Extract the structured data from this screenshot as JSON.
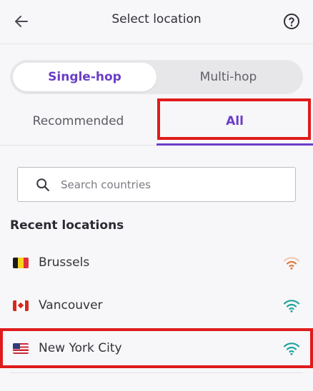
{
  "header": {
    "title": "Select location",
    "back_icon": "arrow-left-icon",
    "help_icon": "question-circle-icon"
  },
  "hop_modes": {
    "single": "Single-hop",
    "multi": "Multi-hop",
    "selected": "single"
  },
  "tabs": {
    "recommended": "Recommended",
    "all": "All",
    "selected": "all"
  },
  "search": {
    "placeholder": "Search countries",
    "value": ""
  },
  "recent": {
    "title": "Recent locations",
    "items": [
      {
        "name": "Brussels",
        "flag": "belgium-flag-icon",
        "signal": "wifi-weak-icon",
        "signal_color": "#e07a3f"
      },
      {
        "name": "Vancouver",
        "flag": "canada-flag-icon",
        "signal": "wifi-strong-icon",
        "signal_color": "#20a39e"
      },
      {
        "name": "New York City",
        "flag": "usa-flag-icon",
        "signal": "wifi-strong-icon",
        "signal_color": "#20a39e"
      }
    ]
  },
  "colors": {
    "accent": "#6a3ec7",
    "highlight": "#e01b1b",
    "signal_good": "#20a39e",
    "signal_weak": "#e07a3f"
  }
}
